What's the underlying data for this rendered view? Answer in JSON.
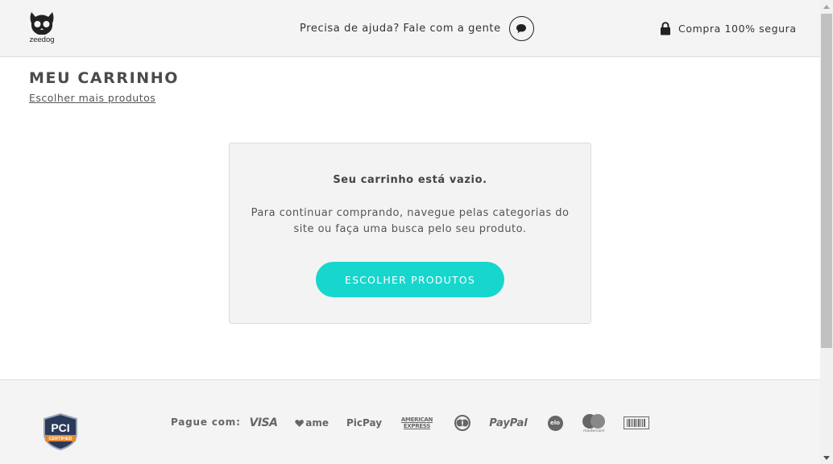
{
  "header": {
    "logo_text": "zeedog",
    "help_text": "Precisa de ajuda? Fale com a gente",
    "secure_text": "Compra 100% segura"
  },
  "cart": {
    "title": "MEU CARRINHO",
    "more_link": "Escolher mais produtos",
    "empty_title": "Seu carrinho está vazio.",
    "empty_text": "Para continuar comprando, navegue pelas categorias do site ou faça uma busca pelo seu produto.",
    "button_label": "ESCOLHER PRODUTOS"
  },
  "footer": {
    "pci_label": "PCI",
    "pci_sub": "CERTIFIED",
    "pay_label": "Pague com:",
    "methods": {
      "visa": "VISA",
      "ame": "ame",
      "picpay": "PicPay",
      "amex_1": "AMERICAN",
      "amex_2": "EXPRESS",
      "paypal": "PayPal",
      "elo": "elo",
      "mastercard": "mastercard"
    }
  },
  "colors": {
    "accent": "#17d6cd",
    "header_bg": "#f4f4f4",
    "card_bg": "#f3f3f3",
    "text_dark": "#333333"
  }
}
